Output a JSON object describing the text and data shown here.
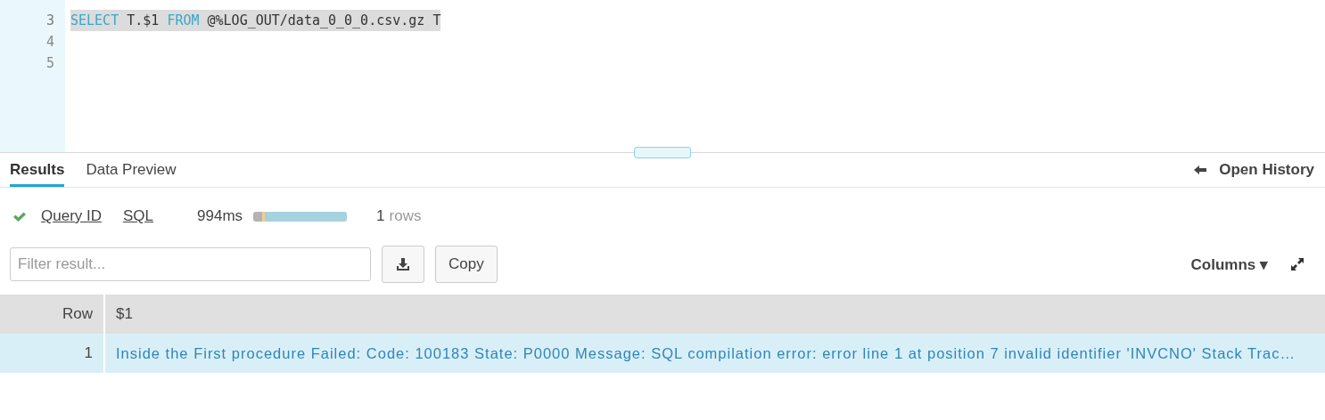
{
  "editor": {
    "lines": [
      {
        "number": "3",
        "selected": true,
        "tokens": [
          {
            "kind": "keyword",
            "text": "SELECT"
          },
          {
            "kind": "plain",
            "text": "T.$1"
          },
          {
            "kind": "keyword",
            "text": "FROM"
          },
          {
            "kind": "plain",
            "text": "@%LOG_OUT/data_0_0_0.csv.gz T"
          }
        ]
      },
      {
        "number": "4",
        "selected": false
      },
      {
        "number": "5",
        "selected": false
      }
    ]
  },
  "tabs": [
    {
      "label": "Results",
      "selected": true
    },
    {
      "label": "Data Preview",
      "selected": false
    }
  ],
  "open_history": "Open History",
  "status": {
    "succeeded": true,
    "links": [
      "Query ID",
      "SQL"
    ],
    "duration": "994ms",
    "timing_bar": [
      {
        "color": "#b3b3b3",
        "level": 0.09
      },
      {
        "color": "#f2cd8a",
        "level": 0.03
      },
      {
        "color": "#a5d2de",
        "level": 0.88
      }
    ],
    "row_count": "1",
    "row_unit": "rows"
  },
  "filter": {
    "placeholder": "Filter result..."
  },
  "copy_button": "Copy",
  "columns_button": "Columns ▾",
  "table": {
    "columns": [
      "Row",
      "$1"
    ],
    "rows": [
      {
        "selected": true,
        "cells": [
          "1",
          "Inside the First procedure Failed: Code: 100183 State: P0000 Message: SQL compilation error: error line 1 at position 7 invalid identifier 'INVCNO' Stack Trac…"
        ]
      }
    ]
  }
}
